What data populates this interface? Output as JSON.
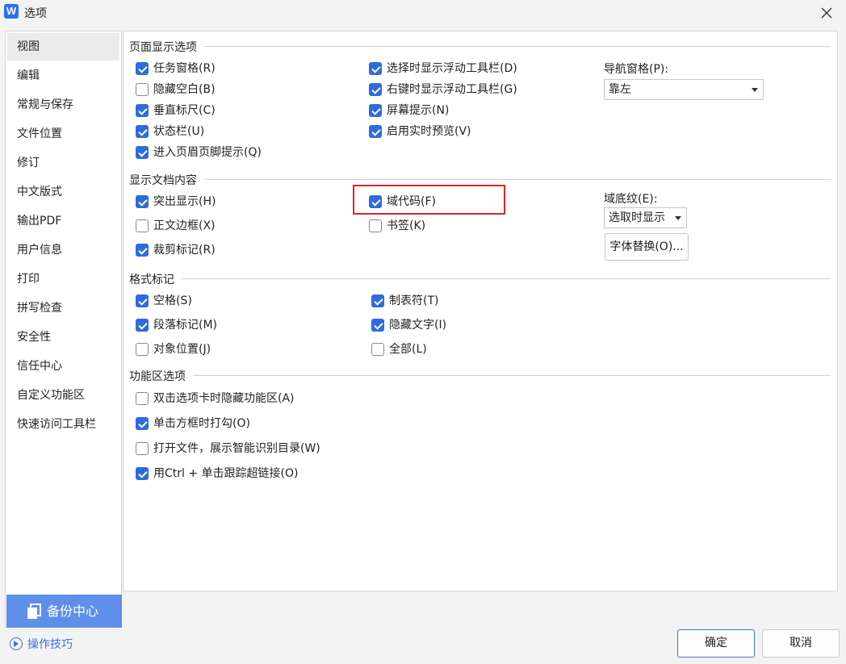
{
  "window": {
    "title": "选项",
    "app_logo": "W"
  },
  "sidebar": {
    "items": [
      {
        "label": "视图"
      },
      {
        "label": "编辑"
      },
      {
        "label": "常规与保存"
      },
      {
        "label": "文件位置"
      },
      {
        "label": "修订"
      },
      {
        "label": "中文版式"
      },
      {
        "label": "输出PDF"
      },
      {
        "label": "用户信息"
      },
      {
        "label": "打印"
      },
      {
        "label": "拼写检查"
      },
      {
        "label": "安全性"
      },
      {
        "label": "信任中心"
      },
      {
        "label": "自定义功能区"
      },
      {
        "label": "快速访问工具栏"
      }
    ],
    "active_index": 0,
    "backup_label": "备份中心",
    "tips_label": "操作技巧"
  },
  "page_display": {
    "title": "页面显示选项",
    "options": [
      {
        "label": "任务窗格(R)",
        "checked": true
      },
      {
        "label": "隐藏空白(B)",
        "checked": false
      },
      {
        "label": "垂直标尺(C)",
        "checked": true
      },
      {
        "label": "状态栏(U)",
        "checked": true
      },
      {
        "label": "进入页眉页脚提示(Q)",
        "checked": true
      },
      {
        "label": "选择时显示浮动工具栏(D)",
        "checked": true
      },
      {
        "label": "右键时显示浮动工具栏(G)",
        "checked": true
      },
      {
        "label": "屏幕提示(N)",
        "checked": true
      },
      {
        "label": "启用实时预览(V)",
        "checked": true
      }
    ],
    "nav_label": "导航窗格(P):",
    "nav_value": "靠左"
  },
  "doc_content": {
    "title": "显示文档内容",
    "options": [
      {
        "label": "突出显示(H)",
        "checked": true
      },
      {
        "label": "正文边框(X)",
        "checked": false
      },
      {
        "label": "裁剪标记(R)",
        "checked": true
      },
      {
        "label": "域代码(F)",
        "checked": true
      },
      {
        "label": "书签(K)",
        "checked": false
      }
    ],
    "field_shading_label": "域底纹(E):",
    "field_shading_value": "选取时显示",
    "font_sub_label": "字体替换(O)..."
  },
  "format_marks": {
    "title": "格式标记",
    "options": [
      {
        "label": "空格(S)",
        "checked": true
      },
      {
        "label": "段落标记(M)",
        "checked": true
      },
      {
        "label": "对象位置(J)",
        "checked": false
      },
      {
        "label": "制表符(T)",
        "checked": true
      },
      {
        "label": "隐藏文字(I)",
        "checked": true
      },
      {
        "label": "全部(L)",
        "checked": false
      }
    ]
  },
  "ribbon": {
    "title": "功能区选项",
    "options": [
      {
        "label": "双击选项卡时隐藏功能区(A)",
        "checked": false
      },
      {
        "label": "单击方框时打勾(O)",
        "checked": true
      },
      {
        "label": "打开文件，展示智能识别目录(W)",
        "checked": false
      },
      {
        "label": "用Ctrl + 单击跟踪超链接(O)",
        "checked": true
      }
    ]
  },
  "footer": {
    "ok_label": "确定",
    "cancel_label": "取消"
  },
  "colors": {
    "accent": "#2d6bde",
    "highlight": "#d9262c",
    "backup_bg": "#5e8fe9"
  },
  "icons": {
    "close": "close-icon",
    "backup": "backup-icon",
    "tips": "play-circle-icon"
  }
}
